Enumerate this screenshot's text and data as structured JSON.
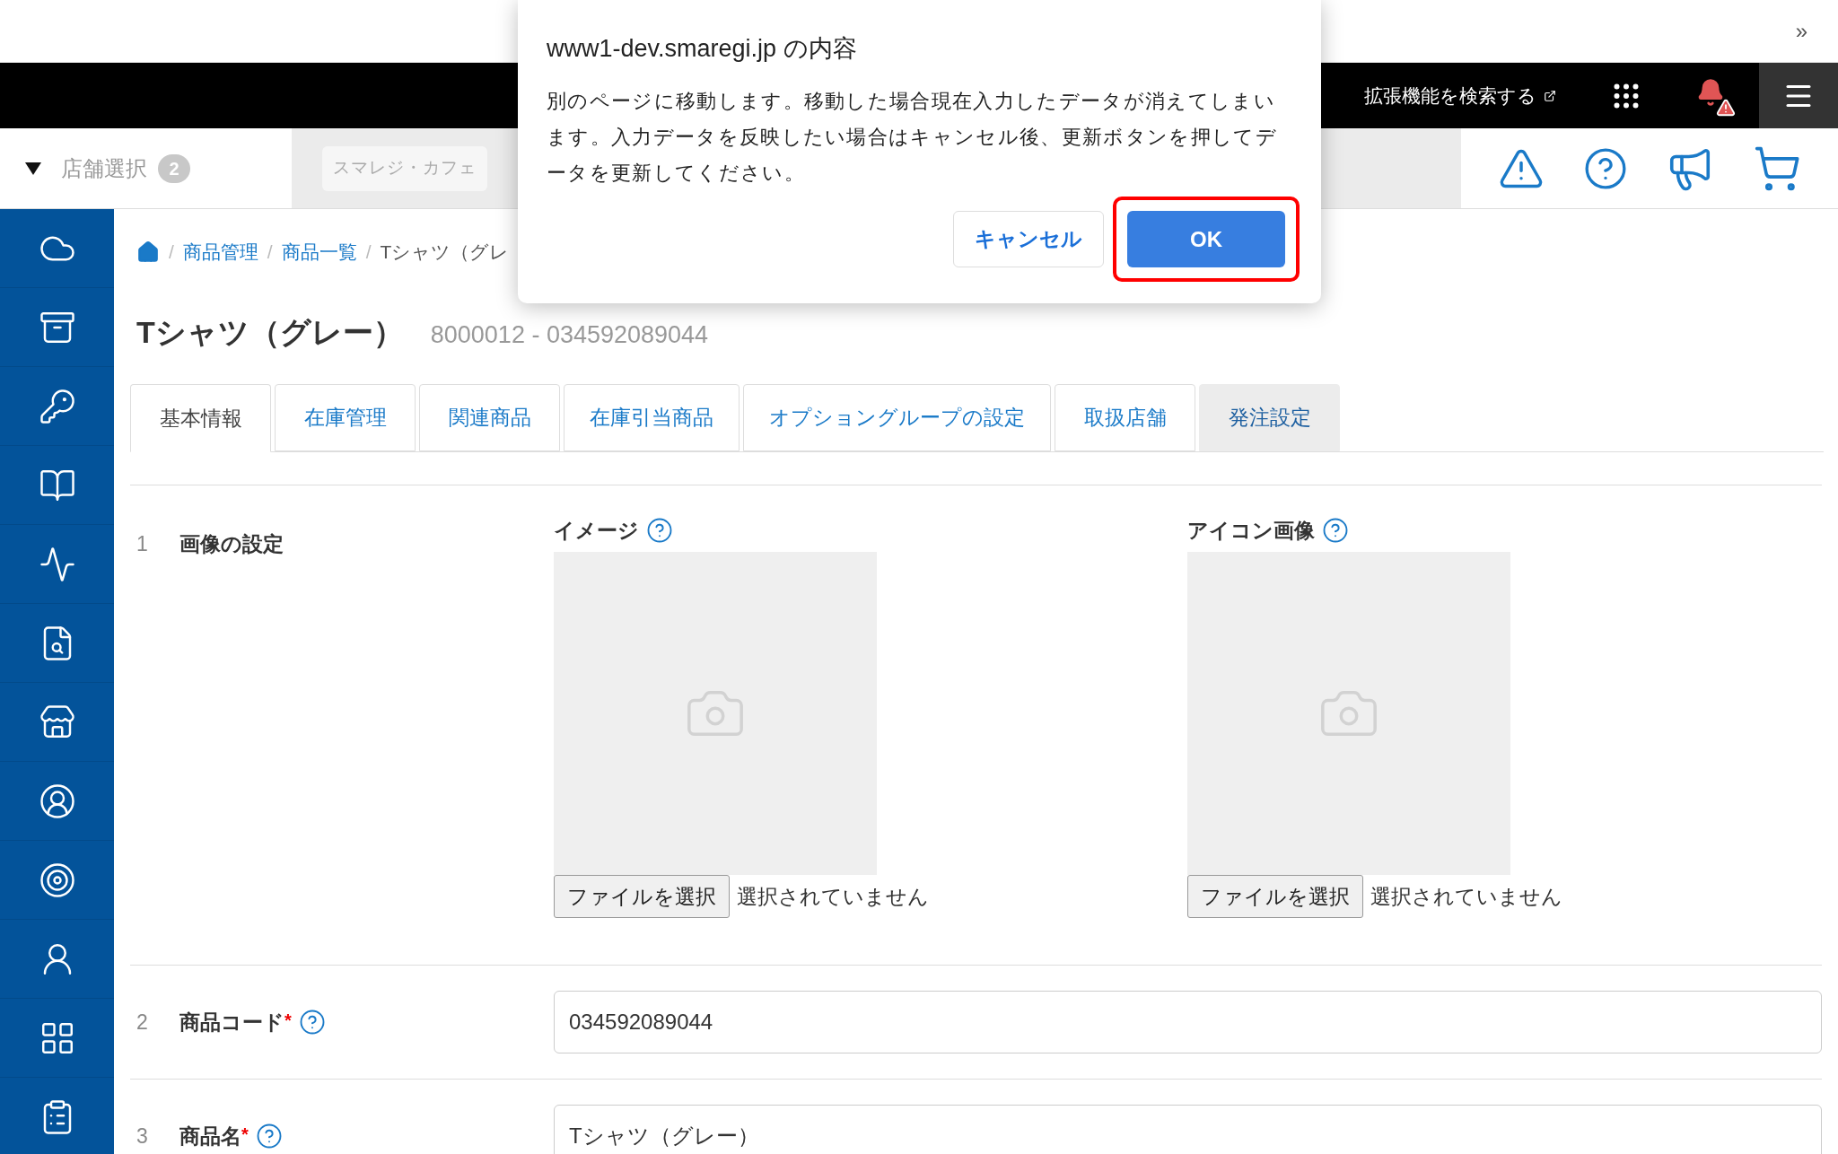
{
  "browser": {
    "expand_label": "»"
  },
  "header": {
    "extensions_link": "拡張機能を検索する",
    "notification_alert": true
  },
  "store_bar": {
    "label": "店舗選択",
    "count": "2",
    "stores": [
      "スマレジ・カフェ"
    ]
  },
  "breadcrumb": [
    {
      "kind": "link",
      "separator": "/",
      "label": "商品管理"
    },
    {
      "kind": "link",
      "separator": "/",
      "label": "商品一覧"
    },
    {
      "kind": "current",
      "separator": "/",
      "label": "Tシャツ（グレ"
    }
  ],
  "product": {
    "name": "Tシャツ（グレー）",
    "code": "8000012 - 034592089044"
  },
  "tabs": [
    {
      "label": "基本情報",
      "selected": true,
      "hovered": false
    },
    {
      "label": "在庫管理",
      "selected": false,
      "hovered": false
    },
    {
      "label": "関連商品",
      "selected": false,
      "hovered": false
    },
    {
      "label": "在庫引当商品",
      "selected": false,
      "hovered": false
    },
    {
      "label": "オプショングループの設定",
      "selected": false,
      "hovered": false
    },
    {
      "label": "取扱店舗",
      "selected": false,
      "hovered": false
    },
    {
      "label": "発注設定",
      "selected": false,
      "hovered": true
    }
  ],
  "form": [
    {
      "kind": "images",
      "number": "1",
      "label": "画像の設定",
      "images": [
        {
          "label": "イメージ",
          "button": "ファイルを選択",
          "status": "選択されていません"
        },
        {
          "label": "アイコン画像",
          "button": "ファイルを選択",
          "status": "選択されていません"
        }
      ]
    },
    {
      "kind": "text",
      "number": "2",
      "label": "商品コード",
      "required_mark": "*",
      "help": true,
      "value": "034592089044"
    },
    {
      "kind": "text",
      "number": "3",
      "label": "商品名",
      "required_mark": "*",
      "help": true,
      "value": "Tシャツ（グレー）"
    }
  ],
  "dialog": {
    "title": "www1-dev.smaregi.jp の内容",
    "message": "別のページに移動します。移動した場合現在入力したデータが消えてしまいます。入力データを反映したい場合はキャンセル後、更新ボタンを押してデータを更新してください。",
    "buttons": [
      {
        "kind": "secondary",
        "label": "キャンセル",
        "focused": false
      },
      {
        "kind": "primary",
        "label": "OK",
        "focused": true
      }
    ]
  }
}
